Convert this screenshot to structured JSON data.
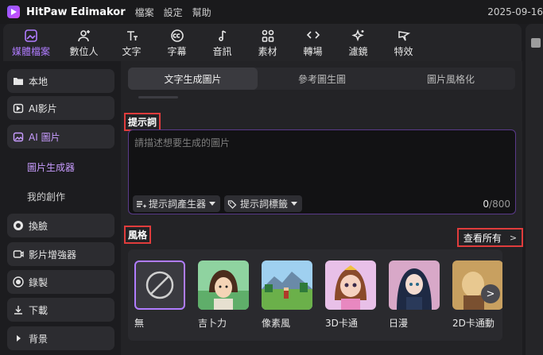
{
  "app": {
    "title": "HitPaw Edimakor",
    "date": "2025-09-16"
  },
  "menu": [
    "檔案",
    "設定",
    "幫助"
  ],
  "toolbar": {
    "items": [
      {
        "label": "媒體檔案",
        "icon": "media-icon",
        "active": true
      },
      {
        "label": "數位人",
        "icon": "avatar-add-icon"
      },
      {
        "label": "文字",
        "icon": "text-icon"
      },
      {
        "label": "字幕",
        "icon": "caption-icon"
      },
      {
        "label": "音訊",
        "icon": "music-icon"
      },
      {
        "label": "素材",
        "icon": "assets-icon"
      },
      {
        "label": "轉場",
        "icon": "transition-icon"
      },
      {
        "label": "濾鏡",
        "icon": "sparkle-icon"
      },
      {
        "label": "特效",
        "icon": "effect-icon"
      }
    ]
  },
  "sidebar": {
    "items": [
      {
        "label": "本地",
        "icon": "folder-icon"
      },
      {
        "label": "AI影片",
        "icon": "ai-video-icon"
      },
      {
        "label": "AI 圖片",
        "icon": "ai-image-icon",
        "active": true
      },
      {
        "label": "換臉",
        "icon": "face-swap-icon"
      },
      {
        "label": "影片增強器",
        "icon": "video-enhance-icon"
      },
      {
        "label": "錄製",
        "icon": "record-icon"
      },
      {
        "label": "下載",
        "icon": "download-icon"
      },
      {
        "label": "背景",
        "icon": "caret-right-icon"
      }
    ],
    "subitems": [
      {
        "label": "圖片生成器",
        "active": true
      },
      {
        "label": "我的創作"
      }
    ]
  },
  "tabs": [
    "文字生成圖片",
    "參考圖生圖",
    "圖片風格化"
  ],
  "prompt": {
    "title": "提示詞",
    "placeholder": "請描述想要生成的圖片",
    "generator_label": "提示詞產生器",
    "tags_label": "提示詞標籤",
    "count": "0",
    "max": "/800"
  },
  "styles": {
    "title": "風格",
    "view_all": "查看所有",
    "items": [
      "無",
      "吉卜力",
      "像素風",
      "3D卡通",
      "日漫",
      "2D卡通動"
    ]
  }
}
